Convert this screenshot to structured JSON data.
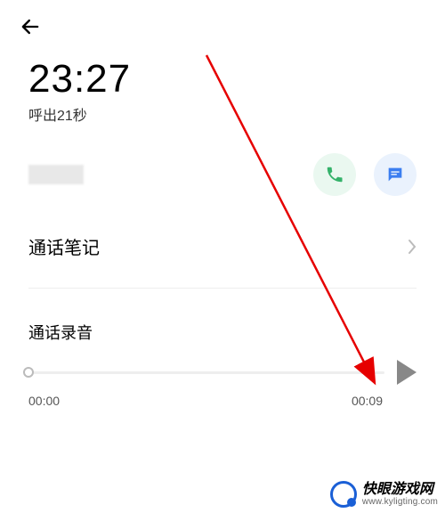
{
  "call": {
    "time": "23:27",
    "duration_label": "呼出21秒"
  },
  "notes": {
    "label": "通话笔记"
  },
  "recording": {
    "label": "通话录音",
    "current_time": "00:00",
    "total_time": "00:09"
  },
  "watermark": {
    "title": "快眼游戏网",
    "url": "www.kyligting.com"
  }
}
